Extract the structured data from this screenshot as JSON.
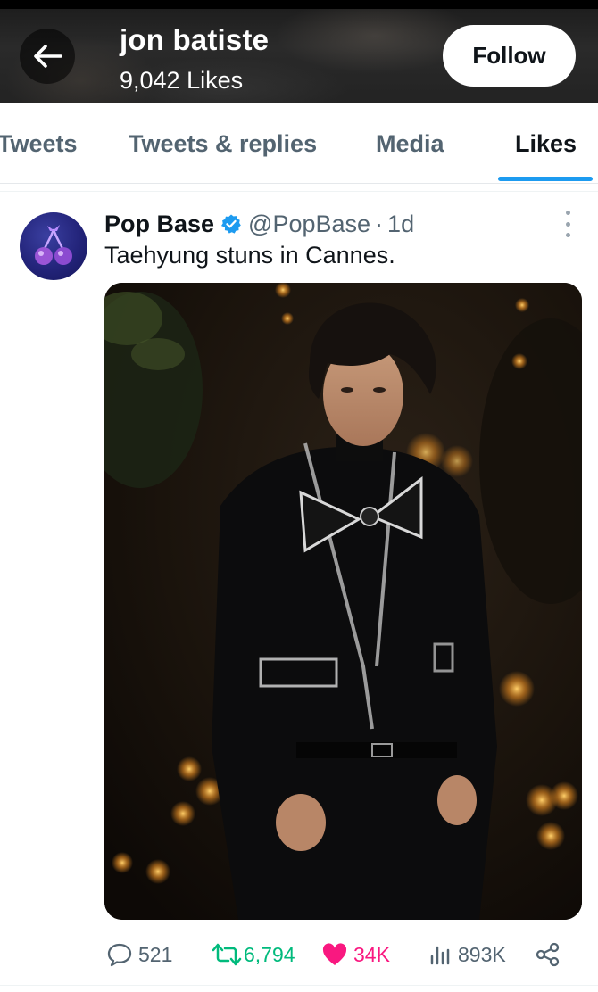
{
  "header": {
    "title": "jon batiste",
    "subtitle": "9,042 Likes",
    "follow_label": "Follow"
  },
  "tabs": [
    {
      "label": "Tweets",
      "active": false
    },
    {
      "label": "Tweets & replies",
      "active": false
    },
    {
      "label": "Media",
      "active": false
    },
    {
      "label": "Likes",
      "active": true
    }
  ],
  "tweet": {
    "author_name": "Pop Base",
    "handle": "@PopBase",
    "separator": "·",
    "time": "1d",
    "text": "Taehyung stuns in Cannes.",
    "verified": true,
    "actions": {
      "replies": "521",
      "retweets": "6,794",
      "likes": "34K",
      "views": "893K"
    }
  },
  "colors": {
    "accent": "#1d9bf0",
    "retweet": "#00ba7c",
    "like": "#f91880",
    "muted": "#536471"
  }
}
